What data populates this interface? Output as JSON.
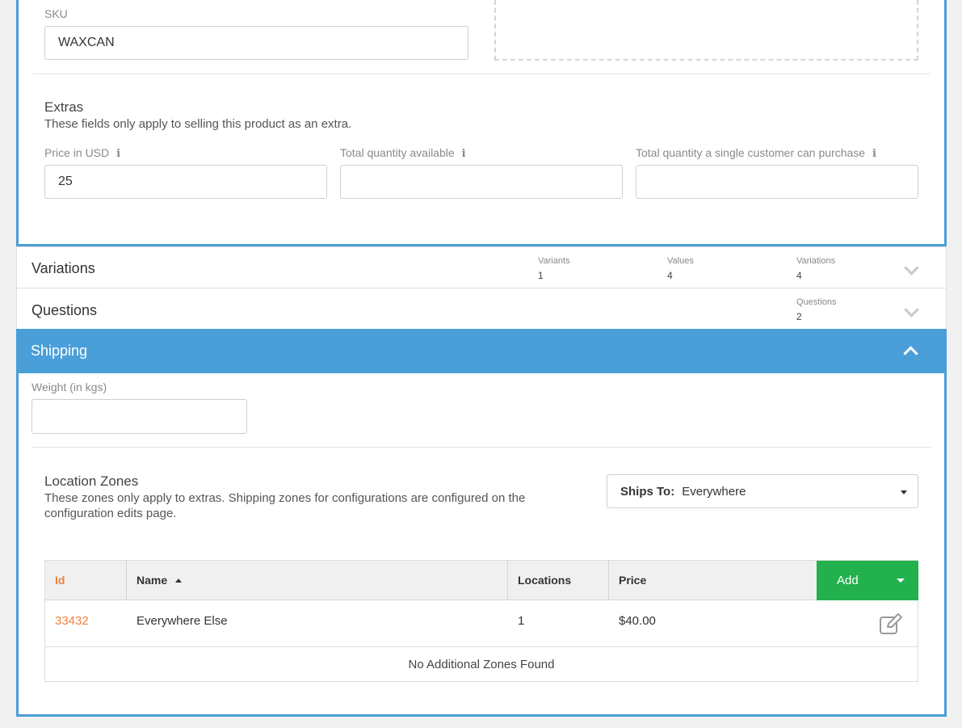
{
  "product": {
    "sku_label": "SKU",
    "sku_value": "WAXCAN"
  },
  "extras": {
    "title": "Extras",
    "description": "These fields only apply to selling this product as an extra.",
    "price_label": "Price in USD",
    "price_value": "25",
    "total_qty_label": "Total quantity available",
    "total_qty_value": "",
    "per_customer_label": "Total quantity a single customer can purchase",
    "per_customer_value": "",
    "info_icon": "info-icon"
  },
  "variations": {
    "title": "Variations",
    "stats": [
      {
        "label": "Variants",
        "value": "1"
      },
      {
        "label": "Values",
        "value": "4"
      },
      {
        "label": "Variations",
        "value": "4"
      }
    ]
  },
  "questions": {
    "title": "Questions",
    "stats": [
      {
        "label": "Questions",
        "value": "2"
      }
    ]
  },
  "shipping": {
    "title": "Shipping",
    "weight_label": "Weight (in kgs)",
    "weight_value": "",
    "zones_title": "Location Zones",
    "zones_description": "These zones only apply to extras. Shipping zones for configurations are configured on the configuration edits page.",
    "ships_to_label": "Ships To:",
    "ships_to_value": "Everywhere",
    "table": {
      "headers": {
        "id": "Id",
        "name": "Name",
        "locations": "Locations",
        "price": "Price"
      },
      "add_label": "Add",
      "rows": [
        {
          "id": "33432",
          "name": "Everywhere Else",
          "locations": "1",
          "price": "$40.00"
        }
      ],
      "empty_message": "No Additional Zones Found"
    }
  },
  "colors": {
    "accent": "#4a9fd8",
    "add_button": "#22b14c",
    "id_link": "#f0823c"
  }
}
